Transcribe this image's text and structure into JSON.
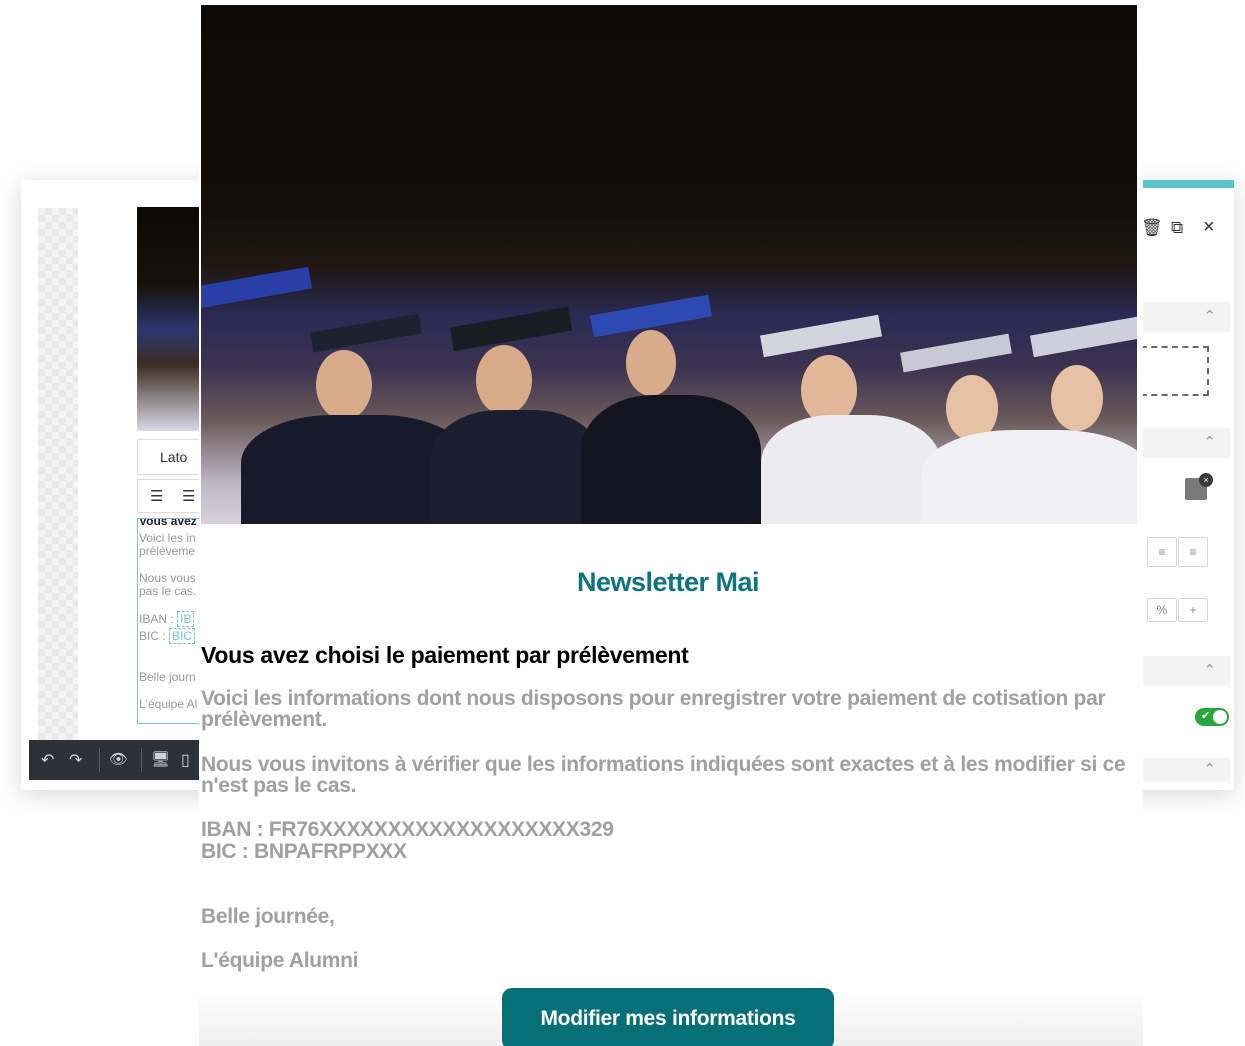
{
  "editor": {
    "font_select": "Lato",
    "mini_text": {
      "l1": "Vous avez",
      "l2": "Voici les in",
      "l3": "prélèveme",
      "l4": "Nous vous",
      "l5": "pas le cas.",
      "iban_label": "IBAN :",
      "iban_chip": "IB",
      "bic_label": "BIC :",
      "bic_chip": "BIC",
      "l8": "Belle journ",
      "l9": "L'équipe Al"
    },
    "toolbar": {
      "undo": "↶",
      "redo": "↷",
      "preview": "👁",
      "desktop": "🖥",
      "mobile": "▯"
    }
  },
  "panel": {
    "accent_color": "#5bc3cb",
    "close": "×",
    "percent": "%",
    "plus": "+",
    "toggle_on": true
  },
  "newsletter": {
    "title": "Newsletter Mai",
    "subtitle": "Vous avez choisi le paiement par prélèvement",
    "intro": "Voici les informations dont nous disposons pour enregistrer votre paiement de cotisation par prélèvement.",
    "check": "Nous vous invitons à vérifier que les informations indiquées sont exactes et à les modifier si ce n'est pas le cas.",
    "iban": "IBAN : FR76XXXXXXXXXXXXXXXXXXX329",
    "bic": "BIC : BNPAFRPPXXX",
    "greeting": "Belle journée,",
    "signature": "L'équipe Alumni",
    "button": "Modifier mes informations",
    "brand_color": "#0c7480",
    "button_color": "#066f78"
  }
}
